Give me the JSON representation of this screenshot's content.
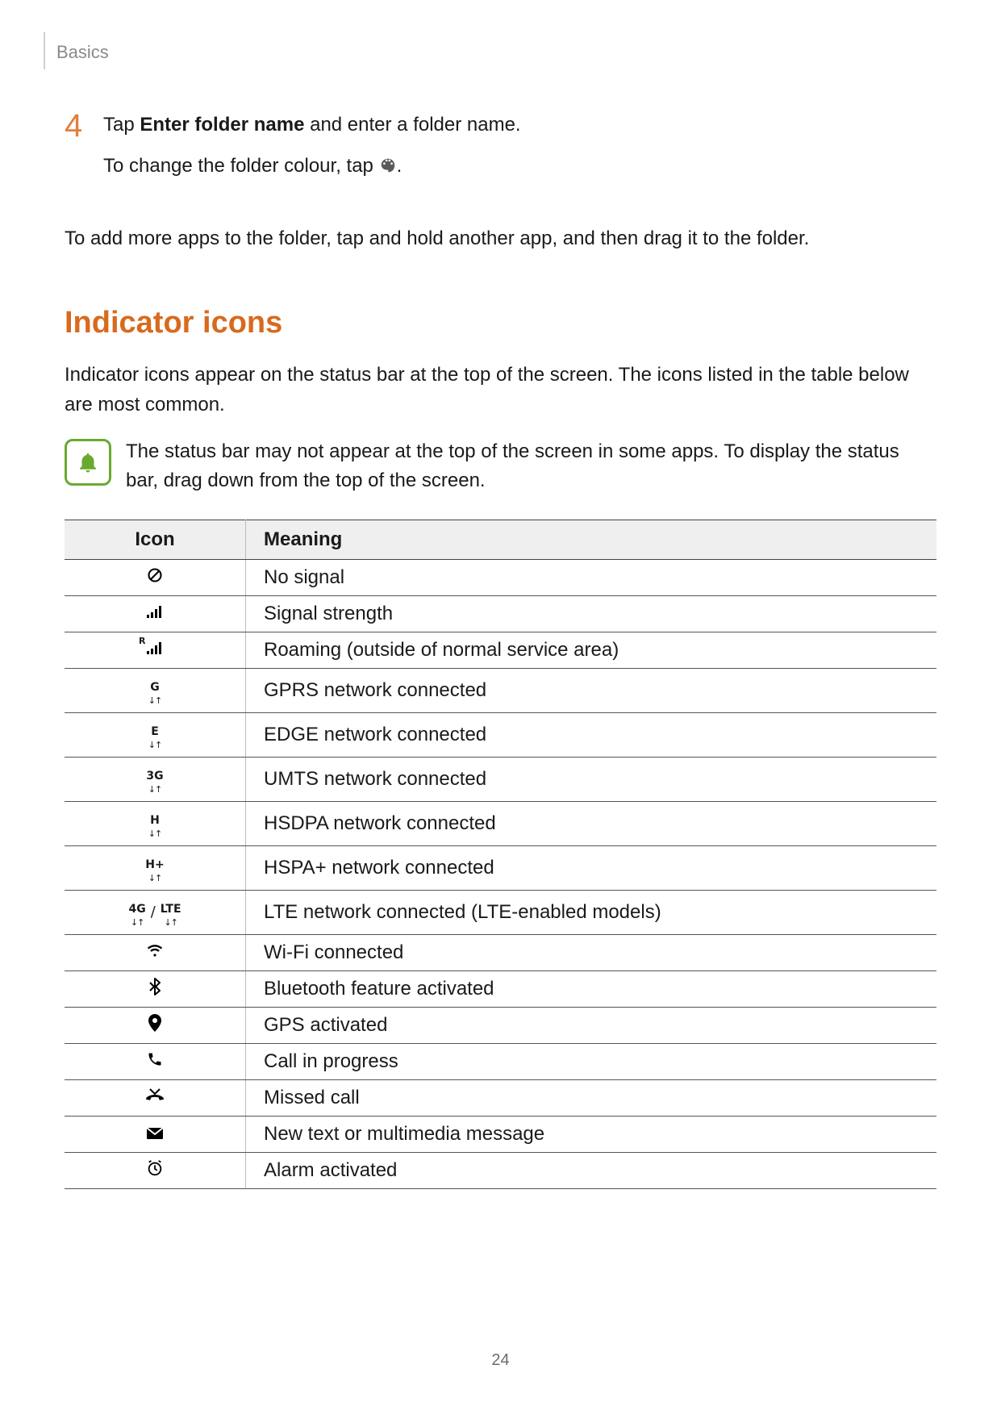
{
  "breadcrumb": "Basics",
  "step": {
    "number": "4",
    "line1_a": "Tap ",
    "line1_bold": "Enter folder name",
    "line1_b": " and enter a folder name.",
    "line2_a": "To change the folder colour, tap ",
    "line2_b": "."
  },
  "paragraph_folder": "To add more apps to the folder, tap and hold another app, and then drag it to the folder.",
  "section_title": "Indicator icons",
  "section_intro": "Indicator icons appear on the status bar at the top of the screen. The icons listed in the table below are most common.",
  "note": "The status bar may not appear at the top of the screen in some apps. To display the status bar, drag down from the top of the screen.",
  "table": {
    "head_icon": "Icon",
    "head_meaning": "Meaning",
    "rows": [
      {
        "id": "no-signal",
        "meaning": "No signal"
      },
      {
        "id": "signal",
        "meaning": "Signal strength"
      },
      {
        "id": "roaming",
        "meaning": "Roaming (outside of normal service area)"
      },
      {
        "id": "gprs",
        "label": "G",
        "meaning": "GPRS network connected"
      },
      {
        "id": "edge",
        "label": "E",
        "meaning": "EDGE network connected"
      },
      {
        "id": "umts",
        "label": "3G",
        "meaning": "UMTS network connected"
      },
      {
        "id": "hsdpa",
        "label": "H",
        "meaning": "HSDPA network connected"
      },
      {
        "id": "hspa-plus",
        "label": "H+",
        "meaning": "HSPA+ network connected"
      },
      {
        "id": "lte",
        "label_a": "4G",
        "label_b": "LTE",
        "meaning": "LTE network connected (LTE-enabled models)"
      },
      {
        "id": "wifi",
        "meaning": "Wi-Fi connected"
      },
      {
        "id": "bluetooth",
        "meaning": "Bluetooth feature activated"
      },
      {
        "id": "gps",
        "meaning": "GPS activated"
      },
      {
        "id": "call",
        "meaning": "Call in progress"
      },
      {
        "id": "missed-call",
        "meaning": "Missed call"
      },
      {
        "id": "message",
        "meaning": "New text or multimedia message"
      },
      {
        "id": "alarm",
        "meaning": "Alarm activated"
      }
    ]
  },
  "page_number": "24"
}
